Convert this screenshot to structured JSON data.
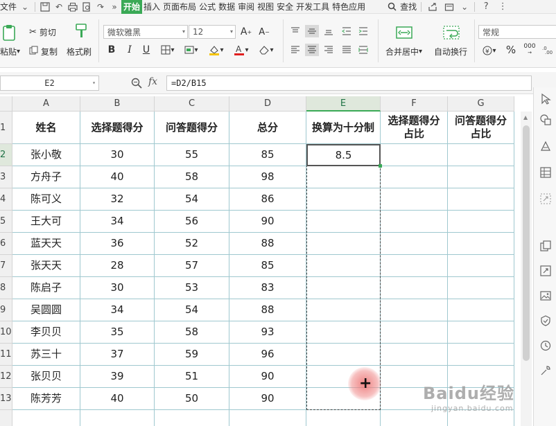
{
  "menu": {
    "file": "文件",
    "tabs": [
      "开始",
      "插入",
      "页面布局",
      "公式",
      "数据",
      "审阅",
      "视图",
      "安全",
      "开发工具",
      "特色应用"
    ],
    "active_tab": "开始",
    "search": "查找"
  },
  "ribbon": {
    "paste": "粘贴",
    "cut": "剪切",
    "copy": "复制",
    "format_painter": "格式刷",
    "font_name": "微软雅黑",
    "font_size": "12",
    "bold": "B",
    "italic": "I",
    "underline": "U",
    "merge_center": "合并居中",
    "wrap_text": "自动换行",
    "number_format": "常规",
    "percent": "%",
    "thousands": "000"
  },
  "formula_bar": {
    "name_box": "E2",
    "fx": "fx",
    "formula": "=D2/B15"
  },
  "sheet": {
    "columns": [
      "A",
      "B",
      "C",
      "D",
      "E",
      "F",
      "G"
    ],
    "row_numbers": [
      "1",
      "2",
      "3",
      "4",
      "5",
      "6",
      "7",
      "8",
      "9",
      "10",
      "11",
      "12",
      "13"
    ],
    "headers": [
      "姓名",
      "选择题得分",
      "问答题得分",
      "总分",
      "换算为十分制",
      "选择题得分\n占比",
      "问答题得分\n占比"
    ],
    "rows": [
      [
        "张小敬",
        "30",
        "55",
        "85",
        "8.5",
        "",
        ""
      ],
      [
        "方舟子",
        "40",
        "58",
        "98",
        "",
        "",
        ""
      ],
      [
        "陈可义",
        "32",
        "54",
        "86",
        "",
        "",
        ""
      ],
      [
        "王大可",
        "34",
        "56",
        "90",
        "",
        "",
        ""
      ],
      [
        "蓝天天",
        "36",
        "52",
        "88",
        "",
        "",
        ""
      ],
      [
        "张天天",
        "28",
        "57",
        "85",
        "",
        "",
        ""
      ],
      [
        "陈启子",
        "30",
        "53",
        "83",
        "",
        "",
        ""
      ],
      [
        "吴圆圆",
        "34",
        "54",
        "88",
        "",
        "",
        ""
      ],
      [
        "李贝贝",
        "35",
        "58",
        "93",
        "",
        "",
        ""
      ],
      [
        "苏三十",
        "37",
        "59",
        "96",
        "",
        "",
        ""
      ],
      [
        "张贝贝",
        "39",
        "51",
        "90",
        "",
        "",
        ""
      ],
      [
        "陈芳芳",
        "40",
        "50",
        "90",
        "",
        "",
        ""
      ]
    ],
    "active_cell": "E2",
    "selected_column": "E"
  },
  "watermark": {
    "main": "Baidu经验",
    "sub": "jingyan.baidu.com"
  },
  "colors": {
    "accent": "#3aa956",
    "grid_line": "#9fc8cf"
  }
}
